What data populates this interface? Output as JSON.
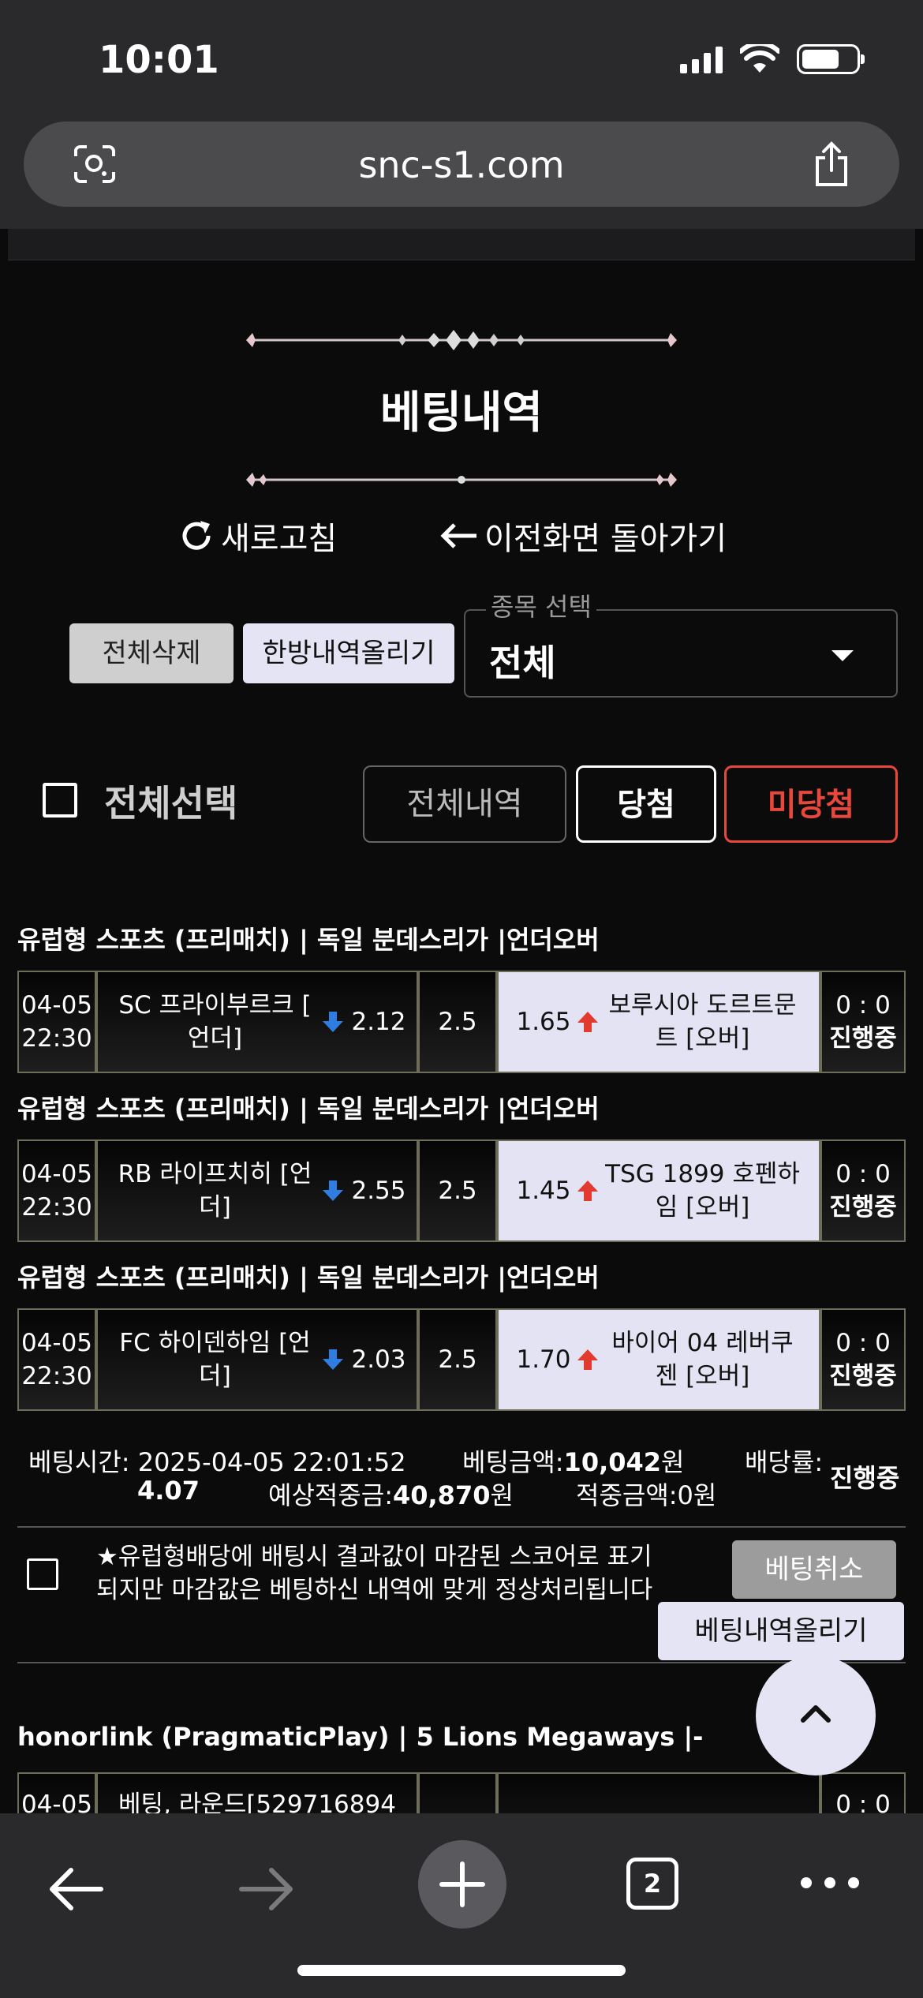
{
  "status": {
    "time": "10:01"
  },
  "browser": {
    "url": "snc-s1.com",
    "tab_count": "2"
  },
  "page": {
    "title": "베팅내역",
    "refresh_label": "새로고침",
    "back_label": "이전화면 돌아가기",
    "delete_all_label": "전체삭제",
    "upload_single_label": "한방내역올리기",
    "select_label": "종목 선택",
    "select_value": "전체",
    "select_all_label": "전체선택",
    "filters": {
      "all": "전체내역",
      "won": "당첨",
      "lost": "미당첨"
    }
  },
  "bets": [
    {
      "header": "유럽형 스포츠 (프리매치) | 독일 분데스리가  |언더오버",
      "date": "04-05",
      "time": "22:30",
      "home_line1": "SC 프라이부르크 [",
      "home_line2": "언더]",
      "home_odds": "2.12",
      "line": "2.5",
      "away_odds": "1.65",
      "away_line1": "보루시아 도르트문",
      "away_line2": "트 [오버]",
      "score": "0 : 0",
      "status": "진행중"
    },
    {
      "header": "유럽형 스포츠 (프리매치) | 독일 분데스리가  |언더오버",
      "date": "04-05",
      "time": "22:30",
      "home_line1": "RB 라이프치히 [언",
      "home_line2": "더]",
      "home_odds": "2.55",
      "line": "2.5",
      "away_odds": "1.45",
      "away_line1": "TSG 1899 호펜하",
      "away_line2": "임 [오버]",
      "score": "0 : 0",
      "status": "진행중"
    },
    {
      "header": "유럽형 스포츠 (프리매치) | 독일 분데스리가  |언더오버",
      "date": "04-05",
      "time": "22:30",
      "home_line1": "FC 하이덴하임 [언",
      "home_line2": "더]",
      "home_odds": "2.03",
      "line": "2.5",
      "away_odds": "1.70",
      "away_line1": "바이어 04 레버쿠",
      "away_line2": "젠 [오버]",
      "score": "0 : 0",
      "status": "진행중"
    }
  ],
  "summary": {
    "bet_time": "베팅시간: 2025-04-05 22:01:52",
    "bet_amount_label": "베팅금액:",
    "bet_amount": "10,042",
    "won_unit": "원",
    "odds_label": "배당률:",
    "odds_value": "4.07",
    "status": "진행중",
    "expected_label": "예상적중금:",
    "expected_amount": "40,870",
    "hit_label": "적중금액:",
    "hit_amount": "0원"
  },
  "notice": {
    "line1": "★유럽형배당에 배팅시 결과값이 마감된 스코어로 표기",
    "line2": "되지만 마감값은 베팅하신 내역에 맞게 정상처리됩니다",
    "cancel_label": "베팅취소",
    "upload_label": "베팅내역올리기"
  },
  "next_bet": {
    "header": "honorlink (PragmaticPlay) | 5 Lions Megaways  |-",
    "date": "04-05",
    "desc": "베팅, 라운드[529716894",
    "score": "0 : 0"
  },
  "colors": {
    "won_border": "#ffffff",
    "lost": "#e8473b",
    "panel_light": "#e3e3f3"
  }
}
